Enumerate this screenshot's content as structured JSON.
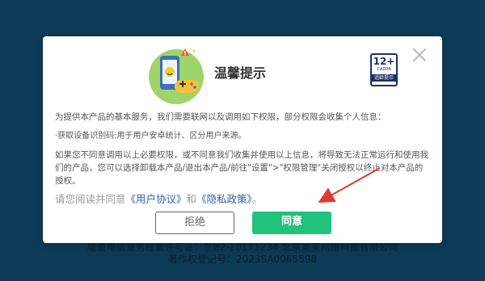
{
  "background": {
    "footer_line1": "增值电信业务经营许可证：京B2-20171234  北京某某网络科技有限公司",
    "footer_line2": "著作权登记号：2023SA0065598"
  },
  "dialog": {
    "title": "温馨提示",
    "badge": {
      "age": "12+",
      "org": "CADPA",
      "label": "适龄提示"
    },
    "paragraphs": [
      "为提供本产品的基本服务，我们需要联网以及调用如下权限，部分权限会收集个人信息：",
      "·获取设备识别码:用于用户安卓统计、区分用户来源。",
      "如果您不同意调用以上必要权限，或不同意我们收集并使用以上信息，将导致无法正常运行和使用我们的产品，您可以选择卸载本产品/退出本产品/前往\"设置\">\"权限管理\"关闭授权以终止对本产品的授权。"
    ],
    "agreement": {
      "prefix": "请您阅读并同意",
      "user_agreement": "《用户协议》",
      "and": "和",
      "privacy_policy": "《隐私政策》",
      "suffix": "。"
    },
    "buttons": {
      "reject": "拒绝",
      "accept": "同意"
    }
  },
  "colors": {
    "background": "#0d3a57",
    "accept_button": "#21c27c",
    "link": "#2f5fa8",
    "annotation_arrow": "#e03a2f"
  },
  "icons": [
    "close-icon",
    "phone-gamepad-icon",
    "age-rating-badge"
  ]
}
